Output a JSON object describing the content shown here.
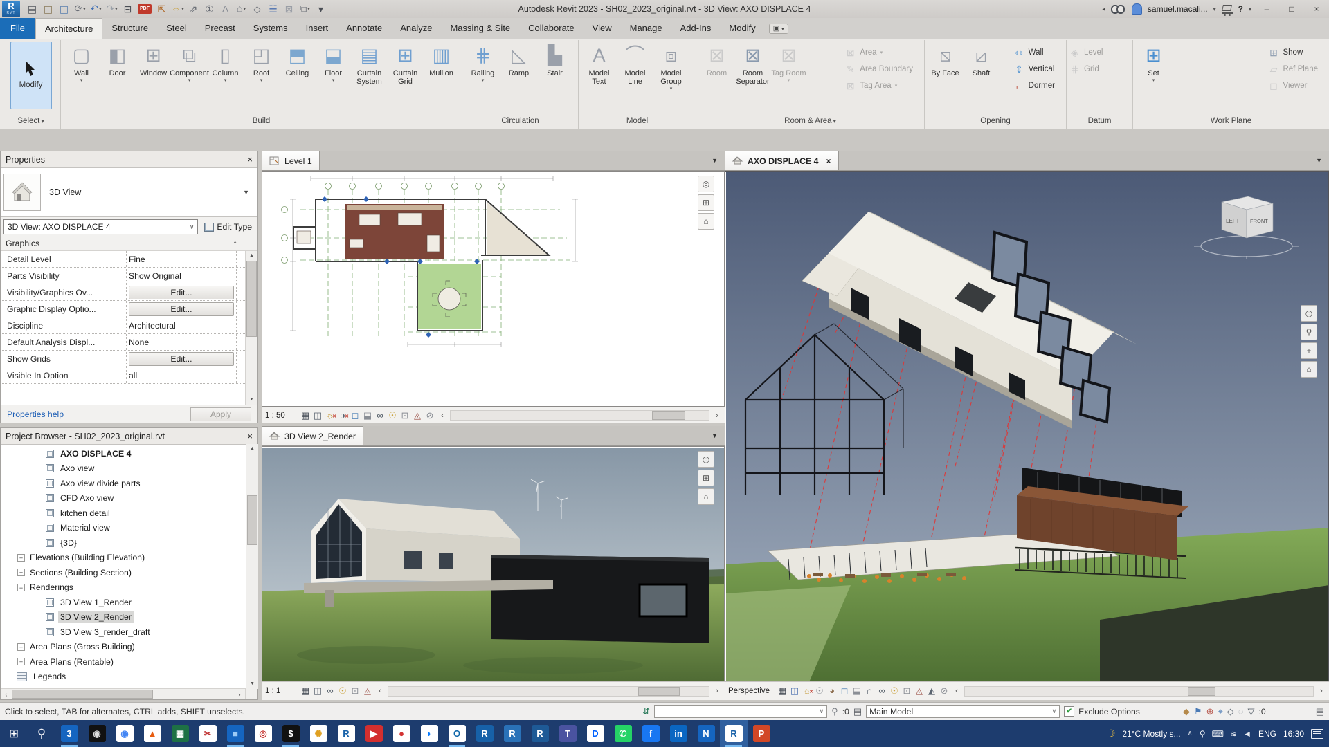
{
  "title_bar": {
    "title": "Autodesk Revit 2023 - SH02_2023_original.rvt - 3D View: AXO DISPLACE 4",
    "user": "samuel.macali...",
    "logo": "R",
    "logo_sub": "RVT",
    "qat": [
      {
        "g": "▤",
        "c": "#55595f"
      },
      {
        "g": "◳",
        "c": "#8a7a5a"
      },
      {
        "g": "◫",
        "c": "#5a7fae"
      },
      {
        "g": "⟳",
        "c": "#6a6e76",
        "dd": 1
      },
      {
        "g": "↶",
        "c": "#3f6fb5",
        "dd": 1
      },
      {
        "g": "↷",
        "c": "#9aa0a8",
        "dd": 1
      },
      {
        "g": "⊟",
        "c": "#4a4e55"
      },
      {
        "g": "PDF",
        "c": "#ffffff",
        "pdf": 1
      },
      {
        "g": "⇱",
        "c": "#b06a2a"
      },
      {
        "g": "⇔",
        "c": "#c9a23c",
        "dd": 1
      },
      {
        "g": "⇗",
        "c": "#6a6e76"
      },
      {
        "g": "①",
        "c": "#6a6e76"
      },
      {
        "g": "A",
        "c": "#8a8e96"
      },
      {
        "g": "⌂",
        "c": "#7a7e86",
        "dd": 1
      },
      {
        "g": "◇",
        "c": "#6a6e76"
      },
      {
        "g": "☱",
        "c": "#4a6fae"
      },
      {
        "g": "⊠",
        "c": "#9a9ea6"
      },
      {
        "g": "⧉",
        "c": "#6a6e76",
        "dd": 1
      },
      {
        "g": "▾",
        "c": "#4a4e55"
      }
    ],
    "win": {
      "min": "–",
      "max": "□",
      "close": "×",
      "help": "?",
      "back": "◂"
    }
  },
  "ribbon": {
    "tabs": [
      {
        "label": "File",
        "file": 1
      },
      {
        "label": "Architecture",
        "active": 1
      },
      {
        "label": "Structure"
      },
      {
        "label": "Steel"
      },
      {
        "label": "Precast"
      },
      {
        "label": "Systems"
      },
      {
        "label": "Insert"
      },
      {
        "label": "Annotate"
      },
      {
        "label": "Analyze"
      },
      {
        "label": "Massing & Site"
      },
      {
        "label": "Collaborate"
      },
      {
        "label": "View"
      },
      {
        "label": "Manage"
      },
      {
        "label": "Add-Ins"
      },
      {
        "label": "Modify"
      }
    ],
    "modify_label": "Modify",
    "panel_labels": {
      "select": "Select",
      "build": "Build",
      "circulation": "Circulation",
      "model": "Model",
      "room_area": "Room & Area",
      "opening": "Opening",
      "datum": "Datum",
      "work_plane": "Work Plane"
    },
    "build": [
      {
        "label": "Wall",
        "g": "▢",
        "c": "#9aa0aa",
        "arrow": 1
      },
      {
        "label": "Door",
        "g": "◧",
        "c": "#9aa0aa"
      },
      {
        "label": "Window",
        "g": "⊞",
        "c": "#9aa0aa"
      },
      {
        "label": "Component",
        "g": "⧉",
        "c": "#9aa0aa",
        "arrow": 1
      },
      {
        "label": "Column",
        "g": "▯",
        "c": "#9aa0aa",
        "arrow": 1
      },
      {
        "label": "Roof",
        "g": "◰",
        "c": "#9aa0aa",
        "arrow": 1
      },
      {
        "label": "Ceiling",
        "g": "⬒",
        "c": "#7ca7cf"
      },
      {
        "label": "Floor",
        "g": "⬓",
        "c": "#7ca7cf",
        "arrow": 1
      },
      {
        "label": "Curtain System",
        "g": "▤",
        "c": "#6f9fd0"
      },
      {
        "label": "Curtain Grid",
        "g": "⊞",
        "c": "#6f9fd0"
      },
      {
        "label": "Mullion",
        "g": "▥",
        "c": "#6f9fd0"
      }
    ],
    "circulation": [
      {
        "label": "Railing",
        "g": "⋕",
        "c": "#6f9fd0",
        "arrow": 1
      },
      {
        "label": "Ramp",
        "g": "◺",
        "c": "#9aa0aa"
      },
      {
        "label": "Stair",
        "g": "▙",
        "c": "#9aa0aa"
      }
    ],
    "model": [
      {
        "label": "Model Text",
        "g": "A",
        "c": "#9aa0aa"
      },
      {
        "label": "Model Line",
        "g": "⌒",
        "c": "#9aa0aa"
      },
      {
        "label": "Model Group",
        "g": "⧈",
        "c": "#9aa0aa",
        "arrow": 1
      }
    ],
    "room_area_big": [
      {
        "label": "Room",
        "g": "⊠",
        "c": "#9aa0aa",
        "dis": 1
      },
      {
        "label": "Room Separator",
        "g": "⊠",
        "c": "#8a9aae"
      },
      {
        "label": "Tag Room",
        "g": "⊠",
        "c": "#9aa0aa",
        "dis": 1,
        "arrow": 1
      }
    ],
    "room_area_small": [
      {
        "label": "Area",
        "g": "⊠",
        "c": "#9aa0aa",
        "dis": 1,
        "arrow": 1
      },
      {
        "label": "Area Boundary",
        "g": "✎",
        "c": "#9aa0aa",
        "dis": 1
      },
      {
        "label": "Tag Area",
        "g": "⊠",
        "c": "#9aa0aa",
        "dis": 1,
        "arrow": 1
      }
    ],
    "opening_big": [
      {
        "label": "By Face",
        "g": "⧅",
        "c": "#9aa0aa"
      },
      {
        "label": "Shaft",
        "g": "⧄",
        "c": "#9aa0aa"
      }
    ],
    "opening_small": [
      {
        "label": "Wall",
        "g": "⇿",
        "c": "#4a8fd0"
      },
      {
        "label": "Vertical",
        "g": "⇕",
        "c": "#4a8fd0"
      },
      {
        "label": "Dormer",
        "g": "⌐",
        "c": "#c05a4a"
      }
    ],
    "datum_small": [
      {
        "label": "Level",
        "g": "◈",
        "c": "#9aa0aa",
        "dis": 1
      },
      {
        "label": "Grid",
        "g": "⋕",
        "c": "#9aa0aa",
        "dis": 1
      }
    ],
    "work_plane_big": [
      {
        "label": "Set",
        "g": "⊞",
        "c": "#4a8fd0",
        "arrow": 1
      }
    ],
    "work_plane_small": [
      {
        "label": "Show",
        "g": "⊞",
        "c": "#8a9aae"
      },
      {
        "label": "Ref Plane",
        "g": "▱",
        "c": "#9aa0aa",
        "dis": 1
      },
      {
        "label": "Viewer",
        "g": "◻",
        "c": "#9aa0aa",
        "dis": 1
      }
    ]
  },
  "properties": {
    "header": "Properties",
    "close": "×",
    "type_name": "3D View",
    "selector": "3D View: AXO DISPLACE 4",
    "edit_type": "Edit Type",
    "section": "Graphics",
    "rows": [
      {
        "name": "Detail Level",
        "value": "Fine"
      },
      {
        "name": "Parts Visibility",
        "value": "Show Original"
      },
      {
        "name": "Visibility/Graphics Ov...",
        "value": "Edit...",
        "button": 1
      },
      {
        "name": "Graphic Display Optio...",
        "value": "Edit...",
        "button": 1
      },
      {
        "name": "Discipline",
        "value": "Architectural"
      },
      {
        "name": "Default Analysis Displ...",
        "value": "None"
      },
      {
        "name": "Show Grids",
        "value": "Edit...",
        "button": 1
      },
      {
        "name": "Visible In Option",
        "value": "all"
      }
    ],
    "help": "Properties help",
    "apply": "Apply"
  },
  "browser": {
    "header": "Project Browser - SH02_2023_original.rvt",
    "close": "×",
    "items": [
      {
        "label": "AXO DISPLACE 4",
        "ind": "50px",
        "view": 1,
        "bold": 1
      },
      {
        "label": "Axo view",
        "ind": "50px",
        "view": 1
      },
      {
        "label": "Axo view divide parts",
        "ind": "50px",
        "view": 1
      },
      {
        "label": "CFD Axo view",
        "ind": "50px",
        "view": 1
      },
      {
        "label": "kitchen detail",
        "ind": "50px",
        "view": 1
      },
      {
        "label": "Material view",
        "ind": "50px",
        "view": 1
      },
      {
        "label": "{3D}",
        "ind": "50px",
        "view": 1
      },
      {
        "label": "Elevations (Building Elevation)",
        "ind": "24px",
        "exp": "+"
      },
      {
        "label": "Sections (Building Section)",
        "ind": "24px",
        "exp": "+"
      },
      {
        "label": "Renderings",
        "ind": "24px",
        "exp": "−"
      },
      {
        "label": "3D View 1_Render",
        "ind": "50px",
        "view": 1
      },
      {
        "label": "3D View 2_Render",
        "ind": "50px",
        "view": 1,
        "sel": 1
      },
      {
        "label": "3D View 3_render_draft",
        "ind": "50px",
        "view": 1
      },
      {
        "label": "Area Plans (Gross Building)",
        "ind": "24px",
        "exp": "+"
      },
      {
        "label": "Area Plans (Rentable)",
        "ind": "24px",
        "exp": "+"
      },
      {
        "label": "Legends",
        "ind": "8px",
        "legend": 1
      }
    ]
  },
  "views": {
    "plan": {
      "tab": "Level 1",
      "scale": "1 : 50"
    },
    "render": {
      "tab": "3D View 2_Render",
      "scale": "1 : 1"
    },
    "axo": {
      "tab": "AXO DISPLACE 4",
      "close": "×",
      "mode": "Perspective",
      "viewcube": {
        "left": "LEFT",
        "front": "FRONT"
      }
    },
    "plan_icons": [
      {
        "g": "▦",
        "c": "#3f4650"
      },
      {
        "g": "◫",
        "c": "#5a6470"
      },
      {
        "g": "☼",
        "c": "#c09020",
        "x": 1
      },
      {
        "g": "◑",
        "c": "#5a6470",
        "x": 1
      },
      {
        "g": "◻",
        "c": "#4a7fb5"
      },
      {
        "g": "⬓",
        "c": "#8a8e95"
      },
      {
        "g": "∞",
        "c": "#4a5560"
      },
      {
        "g": "☉",
        "c": "#caa23c"
      },
      {
        "g": "⊡",
        "c": "#8a8e95"
      },
      {
        "g": "◬",
        "c": "#a05a50"
      },
      {
        "g": "⊘",
        "c": "#8a8e95"
      }
    ],
    "render_icons": [
      {
        "g": "▦",
        "c": "#3f4650"
      },
      {
        "g": "◫",
        "c": "#5a6470"
      },
      {
        "g": "∞",
        "c": "#4a5560"
      },
      {
        "g": "☉",
        "c": "#caa23c"
      },
      {
        "g": "⊡",
        "c": "#8a8e95"
      },
      {
        "g": "◬",
        "c": "#a05a50"
      }
    ],
    "axo_icons": [
      {
        "g": "▦",
        "c": "#3f4650"
      },
      {
        "g": "◫",
        "c": "#4a6fae"
      },
      {
        "g": "☼",
        "c": "#c09020",
        "x": 1
      },
      {
        "g": "☉",
        "c": "#8a8e95"
      },
      {
        "g": "◕",
        "c": "#8a6a4a"
      },
      {
        "g": "◻",
        "c": "#4a7fb5"
      },
      {
        "g": "⬓",
        "c": "#8a8e95"
      },
      {
        "g": "∩",
        "c": "#55606c"
      },
      {
        "g": "∞",
        "c": "#4a5560"
      },
      {
        "g": "☉",
        "c": "#caa23c"
      },
      {
        "g": "⊡",
        "c": "#8a8e95"
      },
      {
        "g": "◬",
        "c": "#a05a50"
      },
      {
        "g": "◭",
        "c": "#5a6470"
      },
      {
        "g": "⊘",
        "c": "#8a8e95"
      }
    ],
    "nav_plan": [
      {
        "g": "◎"
      },
      {
        "g": "⊞"
      },
      {
        "g": "⌂"
      }
    ],
    "nav_render": [
      {
        "g": "◎"
      },
      {
        "g": "⊞"
      },
      {
        "g": "⌂"
      }
    ],
    "nav_axo": [
      {
        "g": "◎"
      },
      {
        "g": "⚲"
      },
      {
        "g": "+"
      },
      {
        "g": "⌂"
      }
    ]
  },
  "status_bar": {
    "hint": "Click to select, TAB for alternates, CTRL adds, SHIFT unselects.",
    "workset_value": "",
    "editable_label": ":0",
    "design_option": "Main Model",
    "check": "✔",
    "exclude_label": "Exclude Options",
    "filter_icon": "▽",
    "filter_label": ":0",
    "right_icons": [
      {
        "g": "◆",
        "c": "#b5894a"
      },
      {
        "g": "⚑",
        "c": "#4a7ab5"
      },
      {
        "g": "⊕",
        "c": "#b5544a"
      },
      {
        "g": "⌖",
        "c": "#4a7ab5"
      },
      {
        "g": "◇",
        "c": "#55606c"
      },
      {
        "g": "◌",
        "c": "#9aa0a8"
      }
    ]
  },
  "taskbar": {
    "apps": [
      {
        "g": "⊞",
        "bg": "transparent",
        "fg": "#ffffff",
        "flat": 1
      },
      {
        "g": "⚲",
        "bg": "transparent",
        "fg": "#e8eaf0",
        "flat": 1
      },
      {
        "g": "3",
        "bg": "#1565c0",
        "fg": "#ffffff",
        "run": 1
      },
      {
        "g": "◉",
        "bg": "#111111",
        "fg": "#dddddd"
      },
      {
        "g": "◉",
        "bg": "#ffffff",
        "fg": "#4285f4"
      },
      {
        "g": "▲",
        "bg": "#ffffff",
        "fg": "#e85d10"
      },
      {
        "g": "▦",
        "bg": "#1e7145",
        "fg": "#ffffff"
      },
      {
        "g": "✂",
        "bg": "#ffffff",
        "fg": "#c03333"
      },
      {
        "g": "■",
        "bg": "#1565c0",
        "fg": "#9ccaf5",
        "run": 1
      },
      {
        "g": "◎",
        "bg": "#ffffff",
        "fg": "#c4302b"
      },
      {
        "g": "$",
        "bg": "#111111",
        "fg": "#ffffff",
        "run": 1
      },
      {
        "g": "✺",
        "bg": "#ffffff",
        "fg": "#e0a020"
      },
      {
        "g": "R",
        "bg": "#ffffff",
        "fg": "#1761a8"
      },
      {
        "g": "▶",
        "bg": "#d32f2f",
        "fg": "#ffffff"
      },
      {
        "g": "●",
        "bg": "#ffffff",
        "fg": "#d33333"
      },
      {
        "g": "◗",
        "bg": "#ffffff",
        "fg": "#0a7cff"
      },
      {
        "g": "O",
        "bg": "#ffffff",
        "fg": "#0a64a8",
        "run": 1
      },
      {
        "g": "R",
        "bg": "#1761a8",
        "fg": "#ffffff"
      },
      {
        "g": "R",
        "bg": "#2a72b8",
        "fg": "#ffffff"
      },
      {
        "g": "R",
        "bg": "#1e5a96",
        "fg": "#ffffff"
      },
      {
        "g": "T",
        "bg": "#4a53a0",
        "fg": "#ffffff"
      },
      {
        "g": "D",
        "bg": "#ffffff",
        "fg": "#0061ff"
      },
      {
        "g": "✆",
        "bg": "#25d366",
        "fg": "#ffffff"
      },
      {
        "g": "f",
        "bg": "#1877f2",
        "fg": "#ffffff"
      },
      {
        "g": "in",
        "bg": "#0a66c2",
        "fg": "#ffffff"
      },
      {
        "g": "N",
        "bg": "#1565c0",
        "fg": "#ffffff"
      },
      {
        "g": "R",
        "bg": "#ffffff",
        "fg": "#1761a8",
        "run": 1,
        "active": 1
      },
      {
        "g": "P",
        "bg": "#d24726",
        "fg": "#ffffff"
      }
    ],
    "tray": {
      "weather_icon": "☽",
      "weather": "21°C  Mostly s...",
      "chev": "∧",
      "icons": [
        {
          "g": "⚲"
        },
        {
          "g": "⌨"
        },
        {
          "g": "≋"
        },
        {
          "g": "◄"
        }
      ],
      "lang": "ENG",
      "time": "16:30"
    }
  }
}
